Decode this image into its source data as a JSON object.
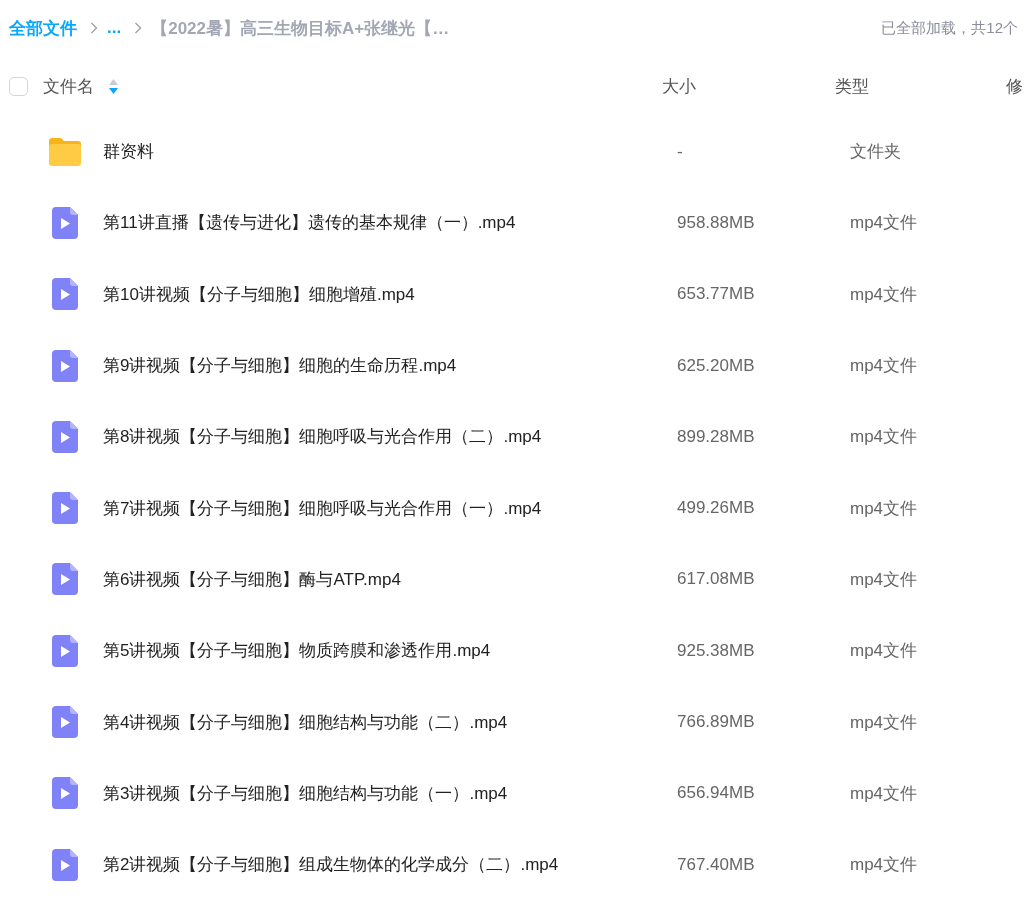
{
  "breadcrumb": {
    "items": [
      {
        "label": "全部文件",
        "kind": "link"
      },
      {
        "label": "...",
        "kind": "link"
      },
      {
        "label": "【2022暑】高三生物目标A+张继光【…",
        "kind": "current"
      }
    ]
  },
  "status": "已全部加载，共12个",
  "table": {
    "select_all": {
      "checked": false
    },
    "columns": [
      {
        "label": "文件名",
        "sorted": true,
        "descending": true
      },
      {
        "label": "大小"
      },
      {
        "label": "类型"
      },
      {
        "label": "修"
      }
    ],
    "rows": [
      {
        "kind": "folder",
        "name": "群资料",
        "size": "-",
        "type": "文件夹"
      },
      {
        "kind": "video",
        "name": "第11讲直播【遗传与进化】遗传的基本规律（一）.mp4",
        "size": "958.88MB",
        "type": "mp4文件"
      },
      {
        "kind": "video",
        "name": "第10讲视频【分子与细胞】细胞增殖.mp4",
        "size": "653.77MB",
        "type": "mp4文件"
      },
      {
        "kind": "video",
        "name": "第9讲视频【分子与细胞】细胞的生命历程.mp4",
        "size": "625.20MB",
        "type": "mp4文件"
      },
      {
        "kind": "video",
        "name": "第8讲视频【分子与细胞】细胞呼吸与光合作用（二）.mp4",
        "size": "899.28MB",
        "type": "mp4文件"
      },
      {
        "kind": "video",
        "name": "第7讲视频【分子与细胞】细胞呼吸与光合作用（一）.mp4",
        "size": "499.26MB",
        "type": "mp4文件"
      },
      {
        "kind": "video",
        "name": "第6讲视频【分子与细胞】酶与ATP.mp4",
        "size": "617.08MB",
        "type": "mp4文件"
      },
      {
        "kind": "video",
        "name": "第5讲视频【分子与细胞】物质跨膜和渗透作用.mp4",
        "size": "925.38MB",
        "type": "mp4文件"
      },
      {
        "kind": "video",
        "name": "第4讲视频【分子与细胞】细胞结构与功能（二）.mp4",
        "size": "766.89MB",
        "type": "mp4文件"
      },
      {
        "kind": "video",
        "name": "第3讲视频【分子与细胞】细胞结构与功能（一）.mp4",
        "size": "656.94MB",
        "type": "mp4文件"
      },
      {
        "kind": "video",
        "name": "第2讲视频【分子与细胞】组成生物体的化学成分（二）.mp4",
        "size": "767.40MB",
        "type": "mp4文件"
      }
    ]
  }
}
